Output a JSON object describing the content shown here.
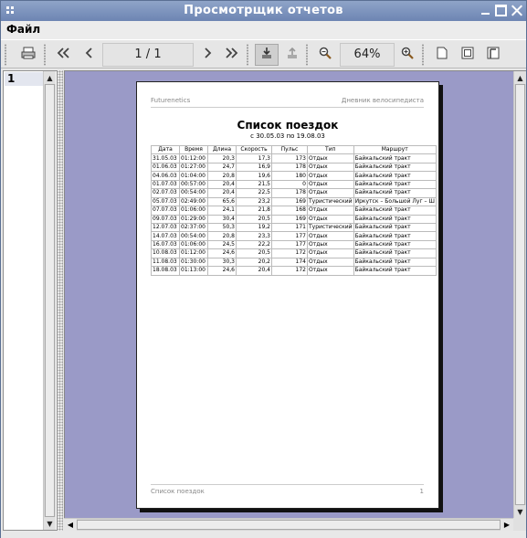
{
  "window": {
    "title": "Просмотрщик отчетов"
  },
  "menu": {
    "items": [
      "Файл"
    ]
  },
  "toolbar": {
    "page_field": "1 / 1",
    "zoom_field": "64%",
    "buttons": [
      {
        "name": "print-icon",
        "glyph": "⎙"
      },
      {
        "name": "first-page-icon",
        "glyph": "«"
      },
      {
        "name": "prev-page-icon",
        "glyph": "‹"
      },
      {
        "name": "next-page-icon",
        "glyph": "›"
      },
      {
        "name": "last-page-icon",
        "glyph": "»"
      },
      {
        "name": "export-icon",
        "glyph": "⤓"
      },
      {
        "name": "import-icon",
        "glyph": "⤒"
      },
      {
        "name": "zoom-out-icon",
        "glyph": "🔍"
      },
      {
        "name": "zoom-in-icon",
        "glyph": "🔍"
      },
      {
        "name": "actual-size-icon",
        "glyph": "▯"
      },
      {
        "name": "fit-page-icon",
        "glyph": "▣"
      },
      {
        "name": "fit-width-icon",
        "glyph": "◫"
      }
    ]
  },
  "thumbnails": {
    "items": [
      "1"
    ]
  },
  "report": {
    "header_left": "Futurenetics",
    "header_right": "Дневник велосипедиста",
    "title": "Список поездок",
    "subtitle": "с 30.05.03 по 19.08.03",
    "columns": [
      "Дата",
      "Время",
      "Длина",
      "Скорость",
      "Пульс",
      "Тип",
      "Маршрут"
    ],
    "rows": [
      [
        "31.05.03",
        "01:12:00",
        "20,3",
        "17,3",
        "173",
        "Отдых",
        "Байкальский тракт"
      ],
      [
        "01.06.03",
        "01:27:00",
        "24,7",
        "16,9",
        "178",
        "Отдых",
        "Байкальский тракт"
      ],
      [
        "04.06.03",
        "01:04:00",
        "20,8",
        "19,6",
        "180",
        "Отдых",
        "Байкальский тракт"
      ],
      [
        "01.07.03",
        "00:57:00",
        "20,4",
        "21,5",
        "0",
        "Отдых",
        "Байкальский тракт"
      ],
      [
        "02.07.03",
        "00:54:00",
        "20,4",
        "22,5",
        "178",
        "Отдых",
        "Байкальский тракт"
      ],
      [
        "05.07.03",
        "02:49:00",
        "65,6",
        "23,2",
        "169",
        "Туристический",
        "Иркутск – Большой Луг – Ш"
      ],
      [
        "07.07.03",
        "01:06:00",
        "24,1",
        "21,8",
        "168",
        "Отдых",
        "Байкальский тракт"
      ],
      [
        "09.07.03",
        "01:29:00",
        "30,4",
        "20,5",
        "169",
        "Отдых",
        "Байкальский тракт"
      ],
      [
        "12.07.03",
        "02:37:00",
        "50,3",
        "19,2",
        "171",
        "Туристический",
        "Байкальский тракт"
      ],
      [
        "14.07.03",
        "00:54:00",
        "20,8",
        "23,3",
        "177",
        "Отдых",
        "Байкальский тракт"
      ],
      [
        "16.07.03",
        "01:06:00",
        "24,5",
        "22,2",
        "177",
        "Отдых",
        "Байкальский тракт"
      ],
      [
        "10.08.03",
        "01:12:00",
        "24,6",
        "20,5",
        "172",
        "Отдых",
        "Байкальский тракт"
      ],
      [
        "11.08.03",
        "01:30:00",
        "30,3",
        "20,2",
        "174",
        "Отдых",
        "Байкальский тракт"
      ],
      [
        "18.08.03",
        "01:13:00",
        "24,6",
        "20,4",
        "172",
        "Отдых",
        "Байкальский тракт"
      ]
    ],
    "footer_left": "Список поездок",
    "footer_right": "1"
  }
}
